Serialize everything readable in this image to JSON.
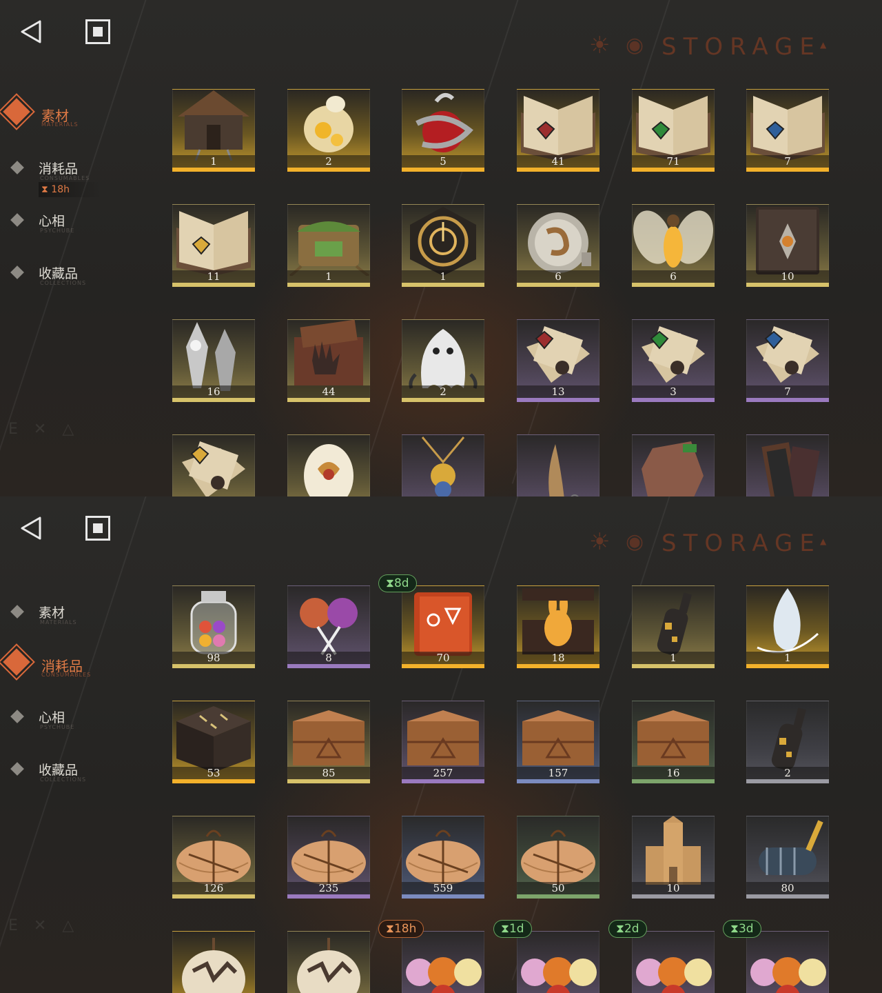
{
  "nav_buttons": {
    "back": "back-triangle",
    "stop": "square-stop"
  },
  "header": {
    "storage_title": "STORAGE",
    "storage_deco": "☀",
    "storage_eye": "◉",
    "storage_tri": "▲"
  },
  "watermark": "E ✕ △",
  "screens": [
    {
      "sidebar": [
        {
          "label": "素材",
          "sub": "MATERIALS",
          "active": true
        },
        {
          "label": "消耗品",
          "sub": "CONSUMABLES",
          "active": false,
          "timer": "18h"
        },
        {
          "label": "心相",
          "sub": "PSYCHUBE",
          "active": false
        },
        {
          "label": "收藏品",
          "sub": "COLLECTIONS",
          "active": false
        }
      ],
      "items": [
        {
          "name": "hut",
          "count": "1",
          "rarity": "gold"
        },
        {
          "name": "sheep",
          "count": "2",
          "rarity": "gold"
        },
        {
          "name": "apple-snake",
          "count": "5",
          "rarity": "gold"
        },
        {
          "name": "book-red",
          "count": "41",
          "rarity": "gold"
        },
        {
          "name": "book-green",
          "count": "71",
          "rarity": "gold"
        },
        {
          "name": "book-blue",
          "count": "7",
          "rarity": "gold"
        },
        {
          "name": "book-gold",
          "count": "11",
          "rarity": "yellow"
        },
        {
          "name": "mossy-chest",
          "count": "1",
          "rarity": "yellow"
        },
        {
          "name": "clockwork",
          "count": "1",
          "rarity": "yellow"
        },
        {
          "name": "pocket-watch",
          "count": "6",
          "rarity": "yellow"
        },
        {
          "name": "firefly",
          "count": "6",
          "rarity": "yellow"
        },
        {
          "name": "tome",
          "count": "10",
          "rarity": "yellow"
        },
        {
          "name": "bullets",
          "count": "16",
          "rarity": "yellow"
        },
        {
          "name": "hand-box",
          "count": "44",
          "rarity": "yellow"
        },
        {
          "name": "ghost",
          "count": "2",
          "rarity": "yellow"
        },
        {
          "name": "scroll-red",
          "count": "13",
          "rarity": "purple"
        },
        {
          "name": "scroll-green",
          "count": "3",
          "rarity": "purple"
        },
        {
          "name": "scroll-blue",
          "count": "7",
          "rarity": "purple"
        },
        {
          "name": "scroll-gold",
          "count": "",
          "rarity": "yellow"
        },
        {
          "name": "egg",
          "count": "",
          "rarity": "yellow"
        },
        {
          "name": "amulet",
          "count": "",
          "rarity": "purple"
        },
        {
          "name": "claw",
          "count": "",
          "rarity": "purple"
        },
        {
          "name": "rock",
          "count": "",
          "rarity": "purple"
        },
        {
          "name": "frame",
          "count": "",
          "rarity": "purple"
        }
      ]
    },
    {
      "sidebar": [
        {
          "label": "素材",
          "sub": "MATERIALS",
          "active": false
        },
        {
          "label": "消耗品",
          "sub": "CONSUMABLES",
          "active": true
        },
        {
          "label": "心相",
          "sub": "PSYCHUBE",
          "active": false
        },
        {
          "label": "收藏品",
          "sub": "COLLECTIONS",
          "active": false
        }
      ],
      "items": [
        {
          "name": "candy-jar",
          "count": "98",
          "rarity": "yellow"
        },
        {
          "name": "lollipops",
          "count": "8",
          "rarity": "purple"
        },
        {
          "name": "rune-book",
          "count": "70",
          "rarity": "gold",
          "timer": "8d",
          "timer_color": "green"
        },
        {
          "name": "rabbit-box",
          "count": "18",
          "rarity": "gold"
        },
        {
          "name": "bottle",
          "count": "1",
          "rarity": "yellow"
        },
        {
          "name": "crystal",
          "count": "1",
          "rarity": "gold"
        },
        {
          "name": "rune-cube",
          "count": "53",
          "rarity": "gold"
        },
        {
          "name": "crate",
          "count": "85",
          "rarity": "yellow"
        },
        {
          "name": "crate",
          "count": "257",
          "rarity": "purple"
        },
        {
          "name": "crate",
          "count": "157",
          "rarity": "blue"
        },
        {
          "name": "crate",
          "count": "16",
          "rarity": "green"
        },
        {
          "name": "bottle",
          "count": "2",
          "rarity": "grey"
        },
        {
          "name": "parcel",
          "count": "126",
          "rarity": "yellow"
        },
        {
          "name": "parcel",
          "count": "235",
          "rarity": "purple"
        },
        {
          "name": "parcel",
          "count": "559",
          "rarity": "blue"
        },
        {
          "name": "parcel",
          "count": "50",
          "rarity": "green"
        },
        {
          "name": "castle",
          "count": "10",
          "rarity": "grey"
        },
        {
          "name": "roller",
          "count": "80",
          "rarity": "grey"
        },
        {
          "name": "bag",
          "count": "",
          "rarity": "gold"
        },
        {
          "name": "bag",
          "count": "",
          "rarity": "yellow"
        },
        {
          "name": "candies",
          "count": "",
          "rarity": "purple",
          "timer": "18h",
          "timer_color": "orange"
        },
        {
          "name": "candies",
          "count": "",
          "rarity": "purple",
          "timer": "1d",
          "timer_color": "green"
        },
        {
          "name": "candies",
          "count": "",
          "rarity": "purple",
          "timer": "2d",
          "timer_color": "green"
        },
        {
          "name": "candies",
          "count": "",
          "rarity": "purple",
          "timer": "3d",
          "timer_color": "green"
        }
      ]
    }
  ]
}
